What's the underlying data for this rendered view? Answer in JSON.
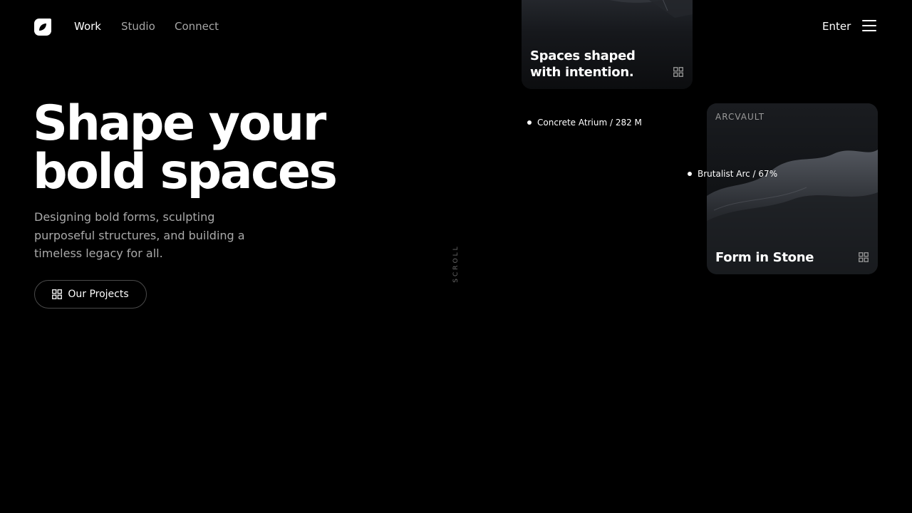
{
  "nav": {
    "links": [
      {
        "label": "Work",
        "active": true
      },
      {
        "label": "Studio",
        "active": false
      },
      {
        "label": "Connect",
        "active": false
      }
    ],
    "enter_label": "Enter",
    "logo_icon": "leaf-logo-icon",
    "menu_icon": "hamburger-menu-icon"
  },
  "hero": {
    "title_line1": "Shape your",
    "title_line2": "bold spaces",
    "subtitle": "Designing bold forms, sculpting purposeful structures, and building a timeless legacy for all.",
    "cta_label": "Our Projects",
    "cta_icon": "grid-icon"
  },
  "scroll_label": "SCROLL",
  "cards": [
    {
      "title": "Spaces shaped with intention.",
      "icon": "grid-icon"
    },
    {
      "tag": "ARCVAULT",
      "title": "Form in Stone",
      "icon": "grid-icon"
    }
  ],
  "annotations": [
    {
      "label": "Concrete Atrium / 282 M"
    },
    {
      "label": "Brutalist Arc / 67%"
    }
  ],
  "colors": {
    "background": "#000000",
    "text": "#ffffff",
    "muted": "#a9a9a9"
  }
}
